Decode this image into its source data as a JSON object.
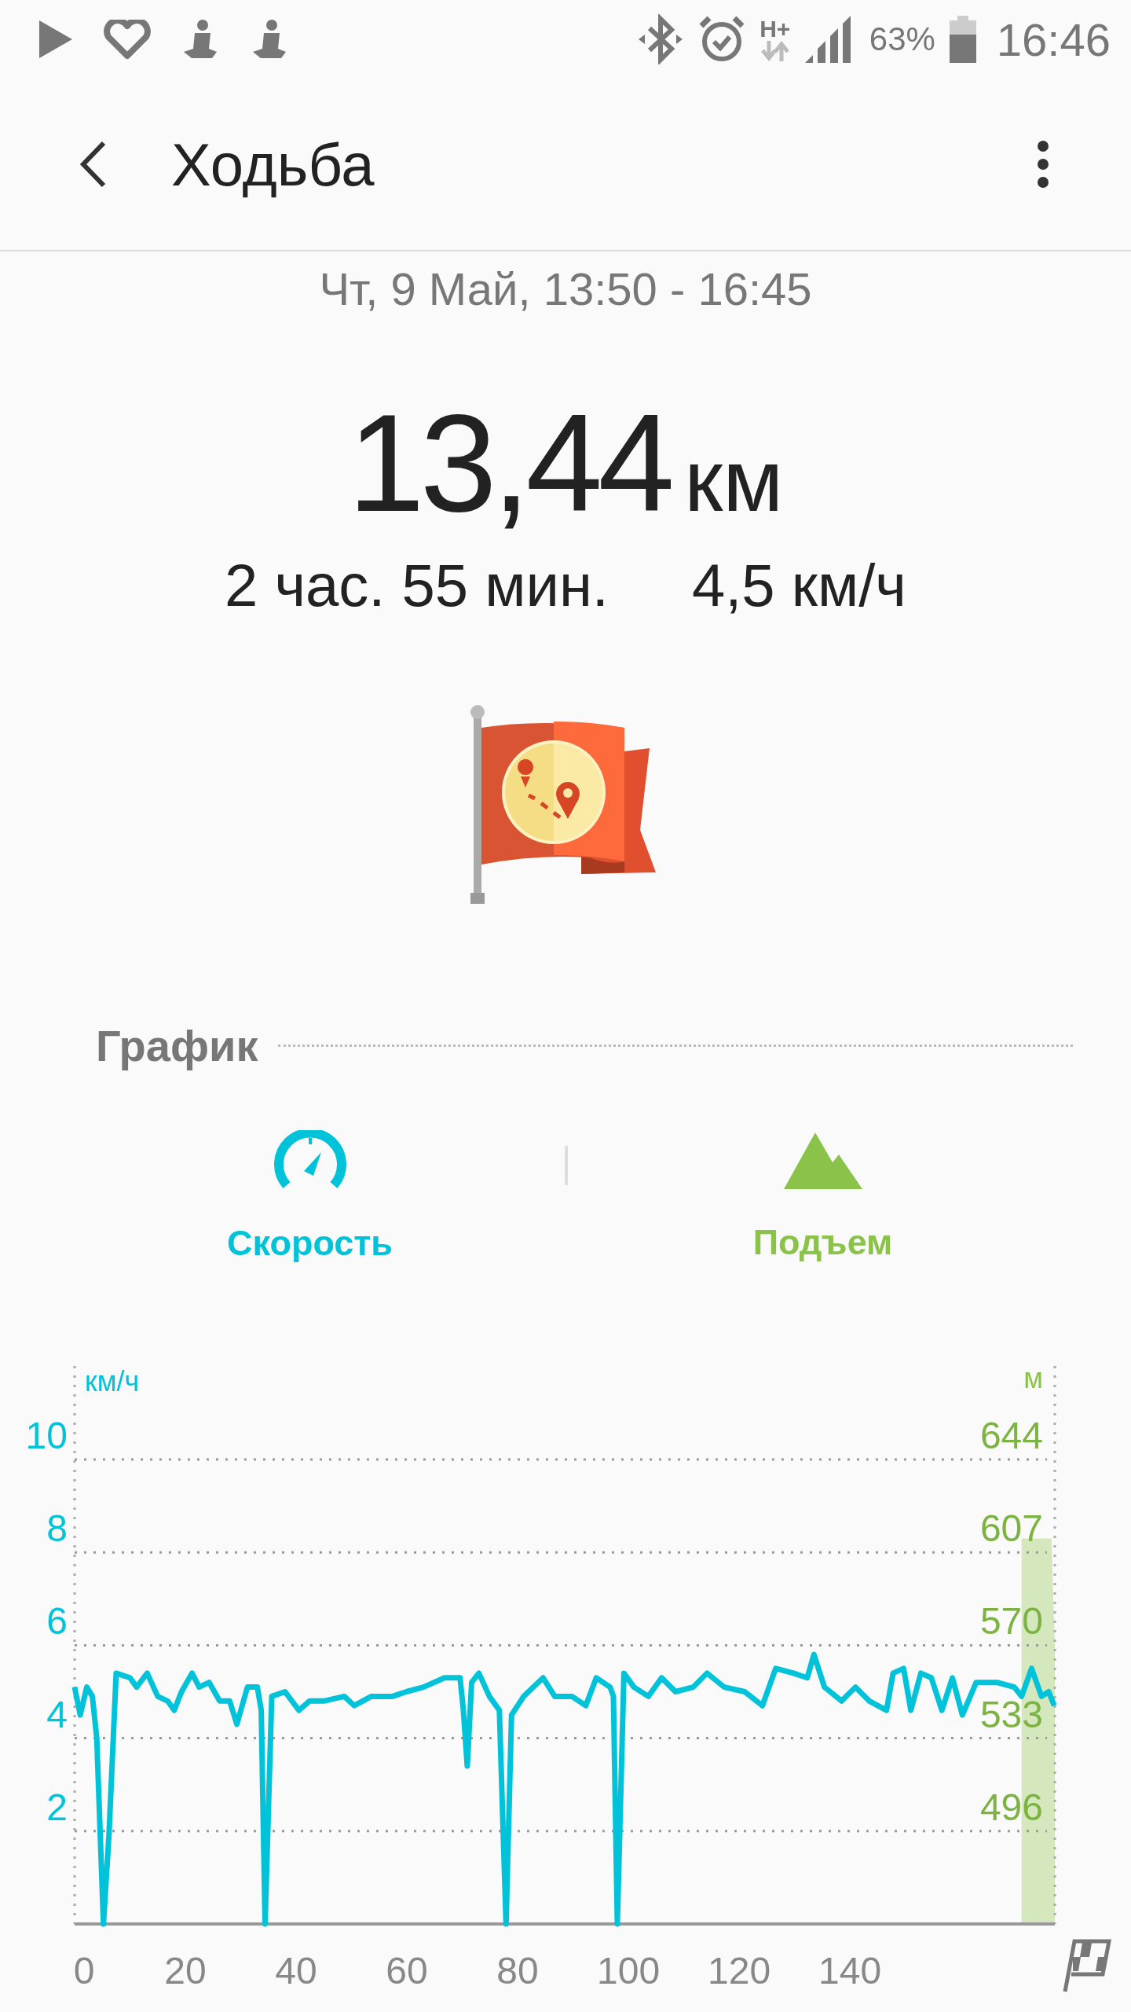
{
  "status_bar": {
    "network": "H+",
    "battery": "63%",
    "time": "16:46"
  },
  "app_bar": {
    "title": "Ходьба"
  },
  "summary": {
    "date": "Чт, 9 Май, 13:50 - 16:45",
    "distance": "13,44",
    "distance_unit": "км",
    "duration": "2 час. 55 мин.",
    "pace": "4,5 км/ч"
  },
  "graph": {
    "heading": "График",
    "toggles": [
      {
        "kind": "speed",
        "label": "Скорость",
        "on": true,
        "color": "#00c3d9"
      },
      {
        "kind": "elevation",
        "label": "Подъем",
        "on": true,
        "color": "#8bc34a"
      }
    ],
    "elevation_unit": "м",
    "elevation_ticks": [
      "644",
      "607",
      "570",
      "533",
      "496"
    ],
    "chart_data": {
      "type": "line",
      "grid": true,
      "ylabel": "км/ч",
      "xlim": [
        0,
        177
      ],
      "ylim": [
        0,
        10
      ],
      "xticks": [
        0,
        20,
        40,
        60,
        80,
        100,
        120,
        140
      ],
      "yticks": [
        2,
        4,
        6,
        8,
        10
      ],
      "x": [
        0,
        1,
        2.2,
        3.2,
        4,
        5.2,
        6.2,
        7.5,
        10,
        11.2,
        13.1,
        15,
        16.8,
        18,
        19.3,
        21.2,
        22.5,
        24.3,
        26.2,
        28,
        29.3,
        31.2,
        33,
        33.7,
        34.4,
        35.6,
        38,
        40.5,
        42.4,
        45,
        48.7,
        50.5,
        53.6,
        57.4,
        59.9,
        63,
        66.8,
        69.6,
        70.2,
        70.9,
        71.7,
        73,
        74.9,
        76.7,
        77.9,
        78.9,
        81.1,
        84.6,
        86.7,
        89.8,
        92.3,
        94.2,
        96.7,
        97.3,
        98,
        99.2,
        101,
        103.6,
        106,
        108.5,
        111.7,
        114.2,
        117.3,
        121,
        124.2,
        126.6,
        129.8,
        132.3,
        133.5,
        135.4,
        138.5,
        141,
        143.5,
        146.6,
        147.8,
        149.7,
        151,
        152.8,
        154.7,
        156.6,
        158.5,
        160.3,
        162.8,
        166.6,
        169.7,
        171,
        172.8,
        174.6,
        175.9,
        176.9
      ],
      "series": [
        {
          "color": "#00c3d9",
          "values": [
            5.1,
            4.5,
            5.1,
            4.9,
            4.0,
            0,
            1.9,
            5.4,
            5.3,
            5.1,
            5.4,
            4.9,
            4.8,
            4.6,
            5.0,
            5.4,
            5.1,
            5.2,
            4.8,
            4.8,
            4.3,
            5.1,
            5.1,
            4.6,
            0,
            4.9,
            5.0,
            4.6,
            4.8,
            4.8,
            4.9,
            4.7,
            4.9,
            4.9,
            5.0,
            5.1,
            5.3,
            5.3,
            4.6,
            3.4,
            5.2,
            5.4,
            4.9,
            4.6,
            0,
            4.5,
            4.9,
            5.3,
            4.9,
            4.9,
            4.7,
            5.3,
            5.1,
            4.9,
            0,
            5.4,
            5.1,
            4.9,
            5.3,
            5.0,
            5.1,
            5.4,
            5.1,
            5.0,
            4.7,
            5.5,
            5.4,
            5.3,
            5.8,
            5.1,
            4.8,
            5.1,
            4.8,
            4.6,
            5.4,
            5.5,
            4.6,
            5.4,
            5.3,
            4.6,
            5.3,
            4.5,
            5.2,
            5.2,
            5.1,
            4.9,
            5.5,
            4.9,
            5.0,
            4.7
          ]
        }
      ]
    }
  }
}
